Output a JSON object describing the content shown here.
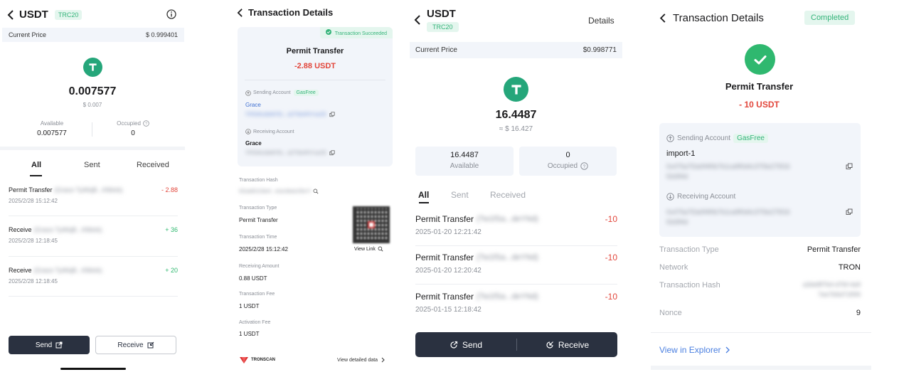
{
  "p1": {
    "title": "USDT",
    "chain_tag": "TRC20",
    "price_label": "Current Price",
    "price_value": "$ 0.999401",
    "balance": "0.007577",
    "balance_usd": "$ 0.007",
    "available_label": "Available",
    "available_value": "0.007577",
    "occupied_label": "Occupied",
    "occupied_value": "0",
    "tabs": [
      "All",
      "Sent",
      "Received"
    ],
    "transactions": [
      {
        "title": "Permit Transfer",
        "party": "(Grace  TpWqB...K8dvb)",
        "date": "2025/2/28 15:12:42",
        "amount": "- 2.88"
      },
      {
        "title": "Receive",
        "party": "(Grace  TpWqB...K8dvb)",
        "date": "2025/2/28 12:18:45",
        "amount": "+ 36"
      },
      {
        "title": "Receive",
        "party": "(Grace  TpWqB...K8dvb)",
        "date": "2025/2/28 12:18:45",
        "amount": "+ 20"
      }
    ],
    "send_label": "Send",
    "receive_label": "Receive"
  },
  "p2": {
    "title": "Transaction Details",
    "status": "Transaction Succeeded",
    "tx_name": "Permit Transfer",
    "amount": "-2.88 USDT",
    "sending_label": "Sending Account",
    "gasfree_tag": "GasFree",
    "sender_name": "Grace",
    "sender_addr": "TPEWfu3bMf7EL...bZT5kHPh7ueZE",
    "receiving_label": "Receiving Account",
    "receiver_name": "Grace",
    "receiver_addr": "TPEWfu3bMf7EL...bZT5kHPh7ueZE",
    "hash_label": "Transaction Hash",
    "hash_value": "9f2ad8f103b4f...4cbc9bde2f9e7f",
    "type_label": "Transaction Type",
    "type_value": "Permit Transfer",
    "time_label": "Transaction Time",
    "time_value": "2025/2/28 15:12:42",
    "recv_amount_label": "Receiving Amount",
    "recv_amount_value": "0.88 USDT",
    "fee_label": "Transaction Fee",
    "fee_value": "1 USDT",
    "activation_label": "Activation Fee",
    "activation_value": "1 USDT",
    "view_link": "View Link",
    "tronscan": "TRONSCAN",
    "view_detailed": "View detailed data"
  },
  "p3": {
    "title": "USDT",
    "chain_tag": "TRC20",
    "details_label": "Details",
    "price_label": "Current Price",
    "price_value": "$0.998771",
    "balance": "16.4487",
    "balance_usd": "≈ $ 16.427",
    "available_value": "16.4487",
    "available_label": "Available",
    "occupied_value": "0",
    "occupied_label": "Occupied",
    "tabs": [
      "All",
      "Sent",
      "Received"
    ],
    "transactions": [
      {
        "title": "Permit Transfer",
        "party": "(Tw1fSa...deYNd)",
        "date": "2025-01-20 12:21:42",
        "amount": "-10"
      },
      {
        "title": "Permit Transfer",
        "party": "(Tw1fSa...deYNd)",
        "date": "2025-01-20 12:20:42",
        "amount": "-10"
      },
      {
        "title": "Permit Transfer",
        "party": "(Tw1fSa...deYNd)",
        "date": "2025-01-15 12:18:42",
        "amount": "-10"
      }
    ],
    "send_label": "Send",
    "receive_label": "Receive"
  },
  "p4": {
    "title": "Transaction Details",
    "status": "Completed",
    "tx_name": "Permit Transfer",
    "amount": "- 10 USDT",
    "sending_label": "Sending Account",
    "gasfree_tag": "GasFree",
    "sender_name": "import-1",
    "sender_addr": "0x475a7f2a0f4f0b7b1ca9f0d4c37f3e275f16",
    "sender_addr2": "f2d3f4d",
    "receiving_label": "Receiving Account",
    "receiver_addr": "0x475a7f2a0f4f0b7b1ca9f0d4c37f3e275f16",
    "receiver_addr2": "f2d3f4d",
    "type_label": "Transaction Type",
    "type_value": "Permit Transfer",
    "network_label": "Network",
    "network_value": "TRON",
    "hash_label": "Transaction Hash",
    "hash_value": "a3de8f7b4-d7bf-4a9",
    "hash_value2": "7ee7b5d71f0f4",
    "nonce_label": "Nonce",
    "nonce_value": "9",
    "explorer_label": "View in Explorer"
  },
  "colors": {
    "green": "#2fb86f",
    "red": "#e2463b",
    "dark_button": "#2a3140",
    "tether": "#25a67a"
  }
}
